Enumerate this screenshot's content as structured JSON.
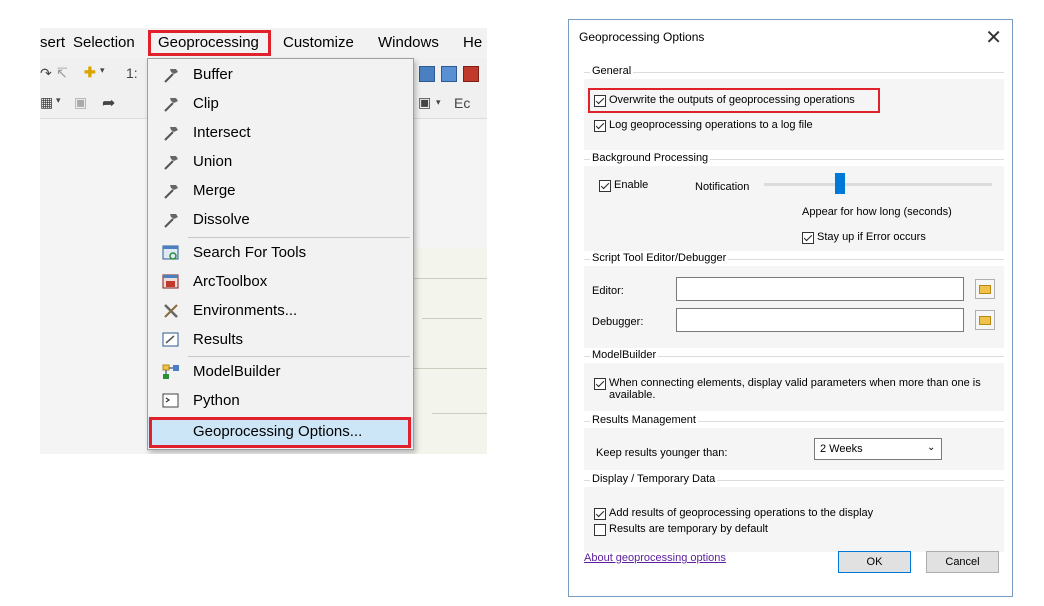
{
  "menubar": {
    "items": [
      "sert",
      "Selection",
      "Geoprocessing",
      "Customize",
      "Windows",
      "He"
    ]
  },
  "toolbar": {
    "scale_fragment": "1:",
    "editor_fragment": "Ec"
  },
  "menu": {
    "items": [
      {
        "label": "Buffer",
        "icon": "hammer-icon"
      },
      {
        "label": "Clip",
        "icon": "hammer-icon"
      },
      {
        "label": "Intersect",
        "icon": "hammer-icon"
      },
      {
        "label": "Union",
        "icon": "hammer-icon"
      },
      {
        "label": "Merge",
        "icon": "hammer-icon"
      },
      {
        "label": "Dissolve",
        "icon": "hammer-icon"
      },
      {
        "label": "Search For Tools",
        "icon": "search-window-icon"
      },
      {
        "label": "ArcToolbox",
        "icon": "toolbox-icon"
      },
      {
        "label": "Environments...",
        "icon": "wrench-screwdriver-icon"
      },
      {
        "label": "Results",
        "icon": "results-icon"
      },
      {
        "label": "ModelBuilder",
        "icon": "modelbuilder-icon"
      },
      {
        "label": "Python",
        "icon": "python-console-icon"
      },
      {
        "label": "Geoprocessing Options...",
        "icon": ""
      }
    ]
  },
  "dialog": {
    "title": "Geoprocessing Options",
    "general": {
      "caption": "General",
      "overwrite": "Overwrite the outputs of geoprocessing operations",
      "overwrite_checked": true,
      "log": "Log geoprocessing operations to a log file",
      "log_checked": true
    },
    "background": {
      "caption": "Background Processing",
      "enable": "Enable",
      "enable_checked": true,
      "notification": "Notification",
      "slider_caption": "Appear for how long (seconds)",
      "stay_up": "Stay up if Error occurs",
      "stay_up_checked": true
    },
    "script": {
      "caption": "Script Tool Editor/Debugger",
      "editor_label": "Editor:",
      "editor_value": "",
      "debugger_label": "Debugger:",
      "debugger_value": ""
    },
    "modelbuilder": {
      "caption": "ModelBuilder",
      "option_line1": "When connecting elements, display valid parameters when more than one is",
      "option_line2": "available.",
      "option_checked": true
    },
    "results": {
      "caption": "Results Management",
      "keep_label": "Keep results younger than:",
      "keep_value": "2 Weeks"
    },
    "display": {
      "caption": "Display / Temporary Data",
      "add_results": "Add results of geoprocessing operations to the display",
      "add_results_checked": true,
      "temporary": "Results are temporary by default",
      "temporary_checked": false
    },
    "about_link": "About geoprocessing options",
    "ok": "OK",
    "cancel": "Cancel"
  },
  "colors": {
    "highlight_box": "#e0202a",
    "menu_hover": "#cde6f7",
    "link": "#5b1e9c"
  }
}
